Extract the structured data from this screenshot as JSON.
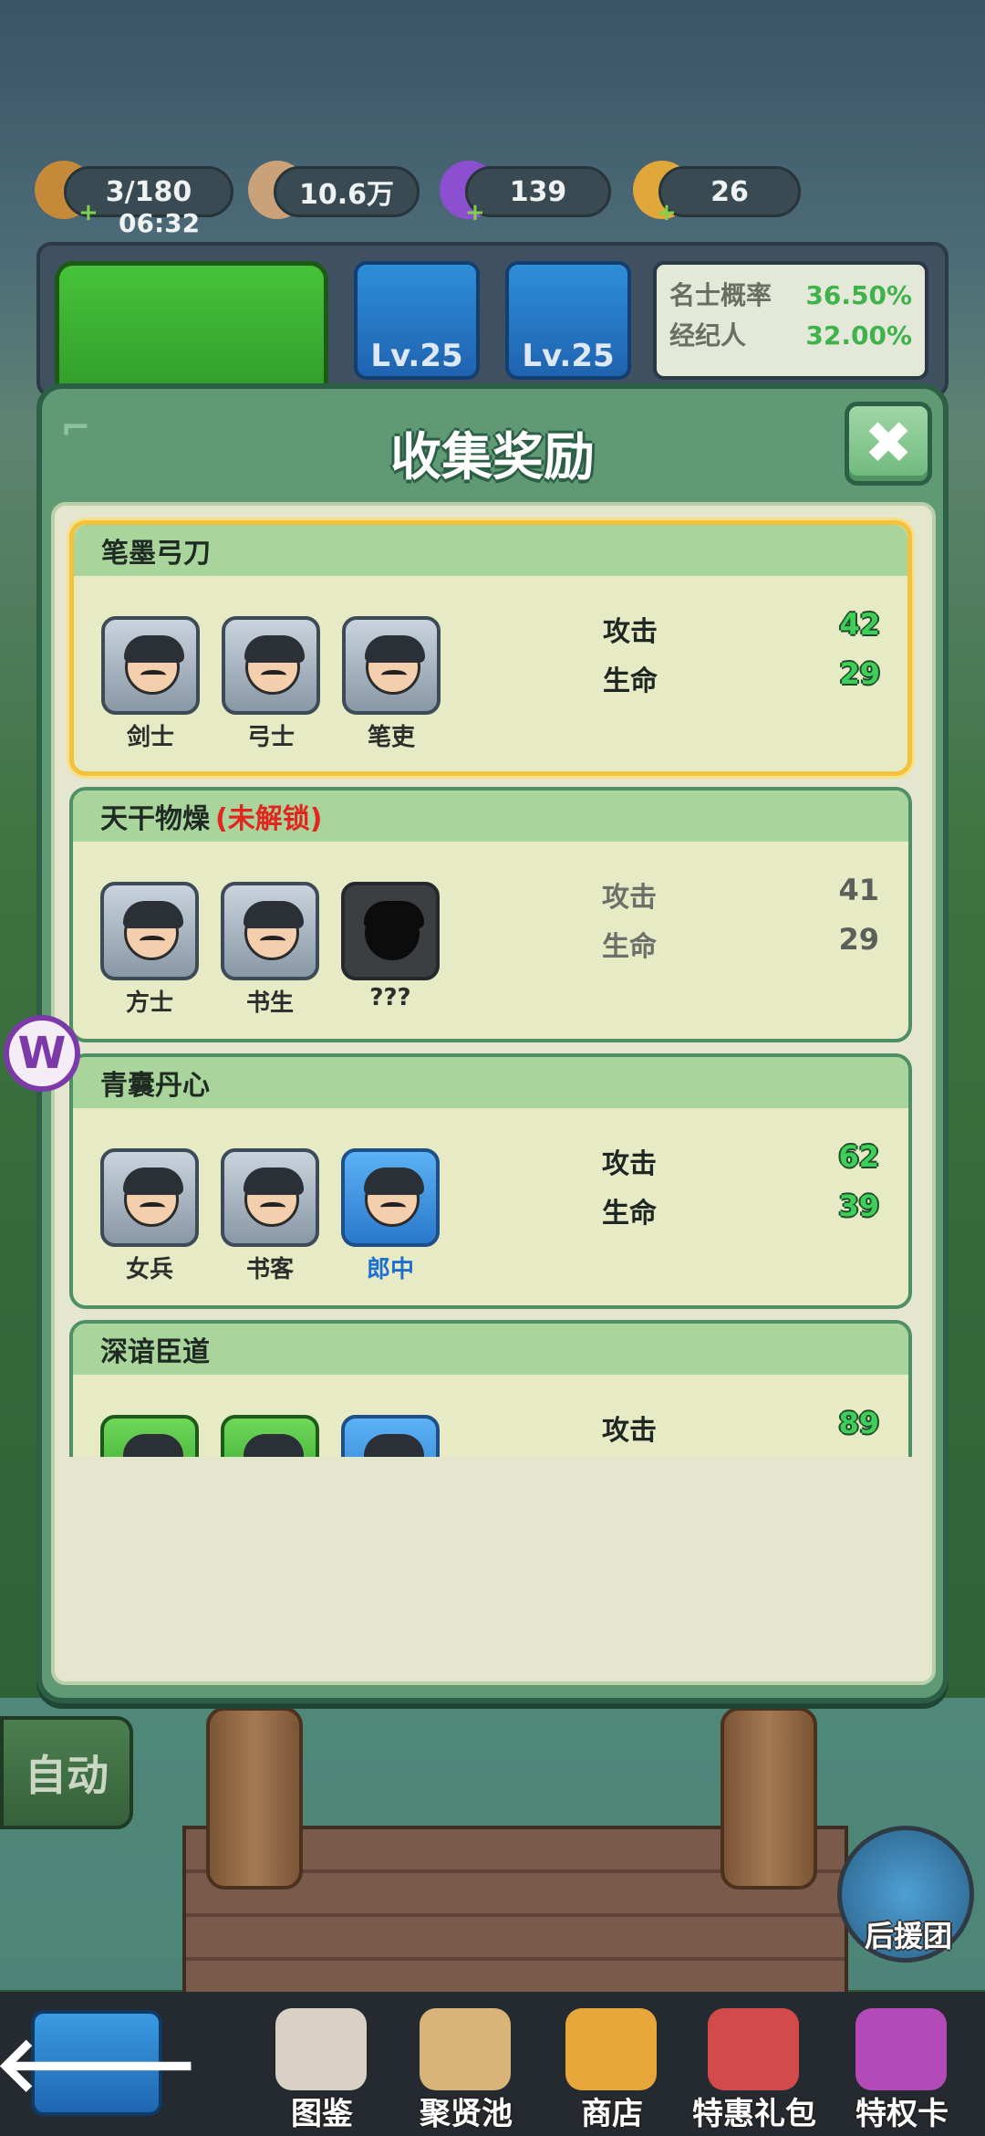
{
  "resources": [
    {
      "name": "stamina",
      "value": "3/180",
      "sub": "06:32",
      "color": "#c48a3a"
    },
    {
      "name": "coins",
      "value": "10.6万",
      "color": "#caa27a"
    },
    {
      "name": "gems",
      "value": "139",
      "color": "#8b4fcf"
    },
    {
      "name": "tickets",
      "value": "26",
      "color": "#e0a83a"
    }
  ],
  "background": {
    "slots": [
      {
        "label": "Lv.25"
      },
      {
        "label": "Lv.25"
      }
    ],
    "stats": [
      {
        "label": "名士概率",
        "value": "36.50%"
      },
      {
        "label": "经纪人",
        "value": "32.00%"
      }
    ]
  },
  "modal": {
    "title": "收集奖励",
    "close_icon": "✖",
    "cards": [
      {
        "title": "笔墨弓刀",
        "locked": false,
        "lock_text": "",
        "heroes": [
          {
            "name": "剑士",
            "tier": "grey"
          },
          {
            "name": "弓士",
            "tier": "grey"
          },
          {
            "name": "笔吏",
            "tier": "grey"
          }
        ],
        "attack_label": "攻击",
        "attack": "42",
        "life_label": "生命",
        "life": "29"
      },
      {
        "title": "天干物燥",
        "locked": true,
        "lock_text": "(未解锁)",
        "heroes": [
          {
            "name": "方士",
            "tier": "grey"
          },
          {
            "name": "书生",
            "tier": "grey"
          },
          {
            "name": "???",
            "tier": "dark"
          }
        ],
        "attack_label": "攻击",
        "attack": "41",
        "life_label": "生命",
        "life": "29"
      },
      {
        "title": "青囊丹心",
        "locked": false,
        "lock_text": "",
        "heroes": [
          {
            "name": "女兵",
            "tier": "grey"
          },
          {
            "name": "书客",
            "tier": "grey"
          },
          {
            "name": "郎中",
            "tier": "blue"
          }
        ],
        "attack_label": "攻击",
        "attack": "62",
        "life_label": "生命",
        "life": "39"
      },
      {
        "title": "深谙臣道",
        "locked": false,
        "lock_text": "",
        "heroes": [
          {
            "name": "",
            "tier": "green"
          },
          {
            "name": "",
            "tier": "green"
          },
          {
            "name": "",
            "tier": "blue"
          }
        ],
        "attack_label": "攻击",
        "attack": "89",
        "life_label": "",
        "life": ""
      }
    ]
  },
  "auto_button": "自动",
  "backup_label": "后援团",
  "bottom_nav": [
    {
      "label": "图鉴",
      "icon": "book-icon",
      "color": "#d9d2c4"
    },
    {
      "label": "聚贤池",
      "icon": "map-icon",
      "color": "#d8b478"
    },
    {
      "label": "商店",
      "icon": "shop-icon",
      "color": "#e6a63a"
    },
    {
      "label": "特惠礼包",
      "icon": "gift-icon",
      "color": "#d24a4a"
    },
    {
      "label": "特权卡",
      "icon": "card-icon",
      "color": "#b34ab8"
    }
  ],
  "back_icon": "🡐",
  "side_logo": "W"
}
